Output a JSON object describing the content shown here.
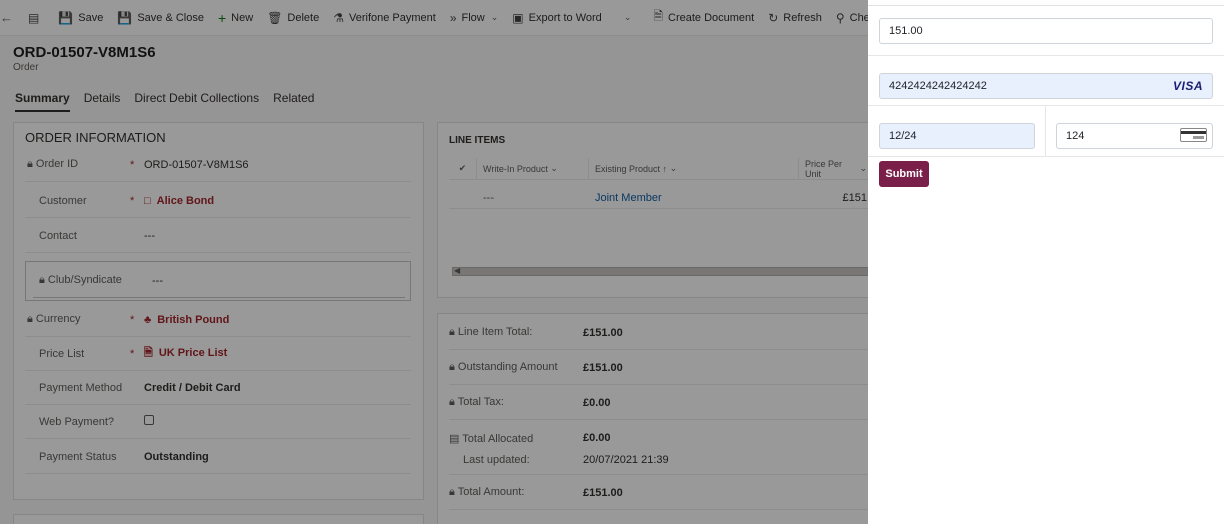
{
  "toolbar": {
    "back_icon": "back-arrow-icon",
    "save": "Save",
    "save_close": "Save & Close",
    "new": "New",
    "delete": "Delete",
    "verifone": "Verifone Payment",
    "flow": "Flow",
    "export_word": "Export to Word",
    "create_document": "Create Document",
    "refresh": "Refresh",
    "check": "Check A"
  },
  "record": {
    "title": "ORD-01507-V8M1S6",
    "type": "Order"
  },
  "tabs": [
    "Summary",
    "Details",
    "Direct Debit Collections",
    "Related"
  ],
  "order_info": {
    "title": "ORDER INFORMATION",
    "rows": [
      {
        "label": "Order ID",
        "required": "*",
        "value": "ORD-01507-V8M1S6"
      },
      {
        "label": "Customer",
        "required": "*",
        "value": "Alice Bond"
      },
      {
        "label": "Contact",
        "value": "---"
      },
      {
        "label": "Club/Syndicate",
        "value": "---"
      },
      {
        "label": "Currency",
        "required": "*",
        "value": "British Pound"
      },
      {
        "label": "Price List",
        "required": "*",
        "value": "UK Price List"
      },
      {
        "label": "Payment Method",
        "value": "Credit / Debit Card"
      },
      {
        "label": "Web Payment?",
        "value": ""
      },
      {
        "label": "Payment Status",
        "value": "Outstanding"
      }
    ]
  },
  "line_items": {
    "title": "LINE ITEMS",
    "columns": [
      "Write-In Product",
      "Existing Product",
      "Price Per Unit"
    ],
    "rows": [
      {
        "write_in": "---",
        "existing": "Joint Member",
        "price": "£151"
      }
    ]
  },
  "totals": {
    "rows": [
      {
        "label": "Line Item Total:",
        "value": "£151.00"
      },
      {
        "label": "Outstanding Amount",
        "value": "£151.00"
      },
      {
        "label": "Total Tax:",
        "value": "£0.00"
      },
      {
        "label": "Total Allocated",
        "value": "£0.00"
      },
      {
        "label": "Last updated:",
        "value": "20/07/2021 21:39"
      },
      {
        "label": "Total Amount:",
        "value": "£151.00"
      }
    ]
  },
  "payment": {
    "amount": "151.00",
    "card_number": "4242424242424242",
    "card_brand": "VISA",
    "expiry": "12/24",
    "cvv": "124",
    "submit": "Submit",
    "submit_color": "#7a1f4a"
  }
}
